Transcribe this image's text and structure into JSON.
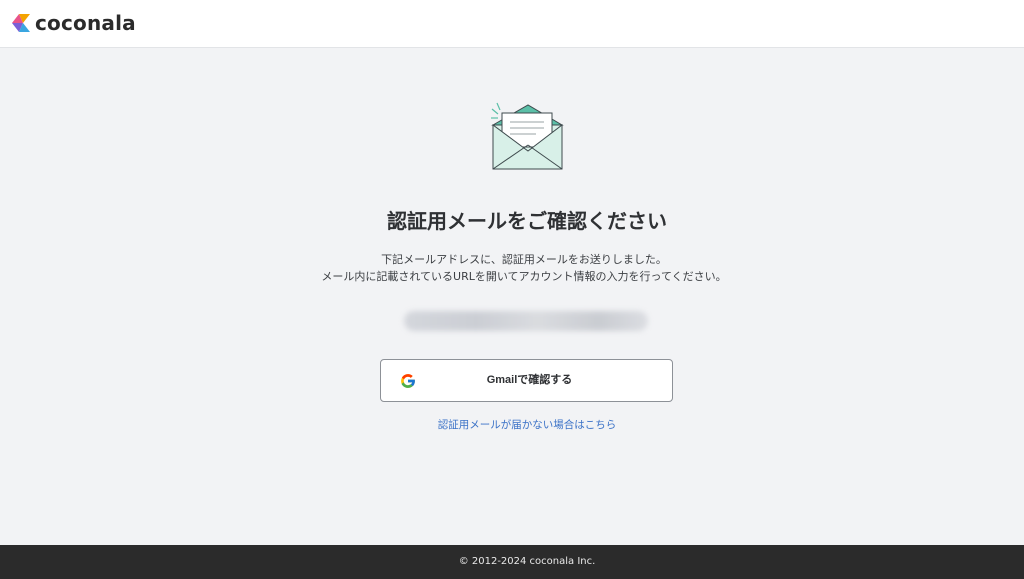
{
  "header": {
    "logo_text": "coconala",
    "logo_icon": "coconala-logo-icon"
  },
  "main": {
    "illustration": "envelope-icon",
    "title": "認証用メールをご確認ください",
    "description_line1": "下記メールアドレスに、認証用メールをお送りしました。",
    "description_line2": "メール内に記載されているURLを開いてアカウント情報の入力を行ってください。",
    "gmail_button": {
      "icon": "google-icon",
      "label": "Gmailで確認する"
    },
    "help_link": "認証用メールが届かない場合はこちら"
  },
  "footer": {
    "copyright": "© 2012-2024 coconala Inc."
  },
  "colors": {
    "page_background": "#f2f3f5",
    "footer_background": "#2b2b2b",
    "link": "#3b72c7",
    "envelope_accent": "#5bbfa7"
  }
}
